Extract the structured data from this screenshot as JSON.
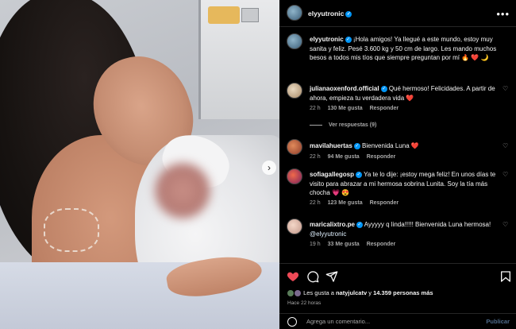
{
  "post": {
    "author": "elyyutronic",
    "caption_user": "elyyutronic",
    "caption": "¡Hola amigos! Ya llegué a este mundo, estoy muy sanita y feliz. Pesé 3.600 kg y 50 cm de largo. Les mando muchos besos a todos mis tíos que siempre preguntan por mí 🔥 ❤️ 🌙",
    "likes_prefix": "Les gusta a",
    "likes_user": "natyjulcatv",
    "likes_suffix": "y",
    "likes_count": "14.359 personas más",
    "time_ago": "Hace 22 horas",
    "add_comment_placeholder": "Agrega un comentario...",
    "publish_label": "Publicar",
    "more_label": "•••",
    "photo_nav": "›"
  },
  "comments": [
    {
      "user": "julianaoxenford.official",
      "text": "Qué hermoso! Felicidades. A partir de ahora, empieza tu verdadera vida ❤️",
      "time": "22 h",
      "likes": "130 Me gusta",
      "reply": "Responder"
    },
    {
      "user": "mavilahuertas",
      "text": "Bienvenida Luna ❤️",
      "time": "22 h",
      "likes": "94 Me gusta",
      "reply": "Responder"
    },
    {
      "user": "sofiagallegosp",
      "text": "Ya te lo dije: ¡estoy mega feliz! En unos días te visito para abrazar a mi hermosa sobrina Lunita. Soy la tía más chocha 💗 😍",
      "time": "22 h",
      "likes": "123 Me gusta",
      "reply": "Responder"
    },
    {
      "user": "maricalixtro.pe",
      "text": "Ayyyyy q linda!!!!! Bienvenida Luna hermosa!",
      "mention": "@elyyutronic",
      "time": "19 h",
      "likes": "33 Me gusta",
      "reply": "Responder"
    }
  ],
  "view_replies": "Ver respuestas (9)",
  "icons": {
    "like": "heart-icon",
    "comment": "comment-icon",
    "share": "share-icon",
    "save": "bookmark-icon"
  },
  "colors": {
    "like_red": "#ed4956",
    "verified_blue": "#0095f6",
    "muted": "#a8a8a8"
  }
}
